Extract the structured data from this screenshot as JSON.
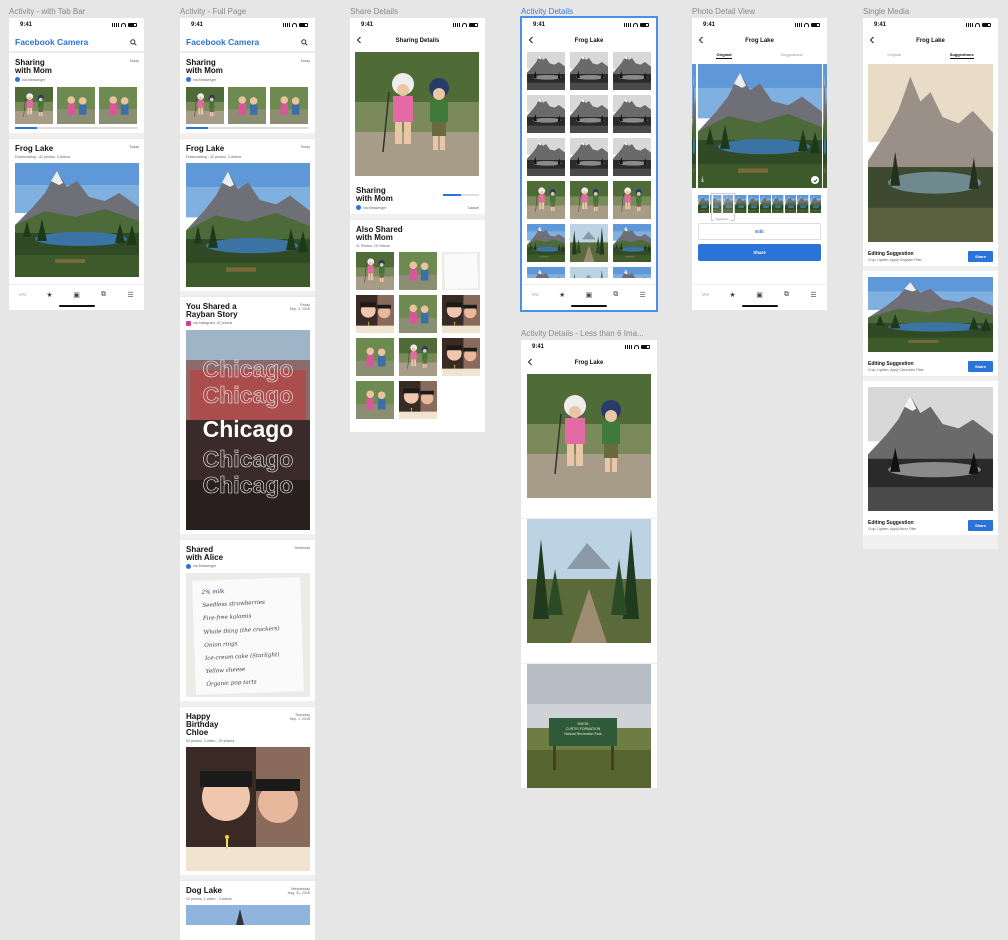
{
  "colors": {
    "accent": "#2a73d8",
    "canvas": "#e6e6e6",
    "selection": "#4a90e2"
  },
  "labels": {
    "f1": "Activity - with Tab Bar",
    "f2": "Activity - Full Page",
    "f3": "Share Details",
    "f4": "Activity Details",
    "f5": "Activity Details - Less than 6 Ima...",
    "f6": "Photo Detail View",
    "f7": "Single Media"
  },
  "status": {
    "time": "9:41"
  },
  "app": {
    "brand": "Facebook Camera"
  },
  "cards": {
    "sharing": {
      "title1": "Sharing",
      "title2": "with Mom",
      "date": "Today",
      "sub": "via Messenger"
    },
    "frog": {
      "title": "Frog Lake",
      "date": "Today",
      "sub": "Downloading - 42 photos, 3 videos"
    },
    "rayban": {
      "title1": "You Shared a",
      "title2": "Rayban Story",
      "date1": "Friday",
      "date2": "Sep. 3, 2016",
      "sub": "via Instagram, 42 photos"
    },
    "alice": {
      "title1": "Shared",
      "title2": "with Alice",
      "date": "Yesterday",
      "sub": "via Messenger"
    },
    "birthday": {
      "title1": "Happy",
      "title2": "Birthday",
      "title3": "Chloe",
      "date1": "Thursday",
      "date2": "Sep. 1, 2016",
      "sub": "83 photos, 3 video - 20 shares"
    },
    "dog": {
      "title": "Dog Lake",
      "date1": "Wednesday",
      "date2": "Aug. 31, 2016",
      "sub": "12 photos, 1 video - 3 videos"
    }
  },
  "story": {
    "word": "Chicago"
  },
  "note_lines": [
    "2% milk",
    "Seedless strawberries",
    "Fire-free kalamis",
    "Whole thing (the crackers)",
    "Onion rings",
    "Ice-cream cake (Starlight)",
    "Yellow cheese",
    "Organic pop tarts"
  ],
  "share_details": {
    "nav_title": "Sharing Details",
    "title1": "Sharing",
    "title2": "with Mom",
    "sub": "via Messenger",
    "cancel": "Cancel",
    "also_title1": "Also Shared",
    "also_title2": "with Mom",
    "also_sub": "11 Photos, 19 Videos"
  },
  "activity_details": {
    "nav_title": "Frog Lake"
  },
  "photo_detail": {
    "nav_title": "Frog Lake",
    "seg_original": "Original",
    "seg_suggestions": "Suggestions",
    "filmstrip_tag": "Suggestion",
    "edit": "Edit",
    "share": "Share"
  },
  "single_media": {
    "nav_title": "Frog Lake",
    "seg_original": "Original",
    "seg_suggestions": "Suggestions",
    "items": [
      {
        "title": "Editing Suggestion",
        "sub": "Crop, Lighten, Apply Gingham Filter",
        "button": "Share"
      },
      {
        "title": "Editing Suggestion",
        "sub": "Crop, Lighten, Apply Clarendon Filter",
        "button": "Share"
      },
      {
        "title": "Editing Suggestion",
        "sub": "Crop, Lighten, Apply Moon Filter",
        "button": "Share"
      }
    ]
  },
  "sign": {
    "line1": "BISON",
    "line2": "CURTIS FORMATION",
    "line3": "Natural Recreation Park"
  },
  "tabs": [
    "activity-tab-icon",
    "favorites-tab-icon",
    "photos-tab-icon",
    "albums-tab-icon",
    "menu-tab-icon"
  ]
}
